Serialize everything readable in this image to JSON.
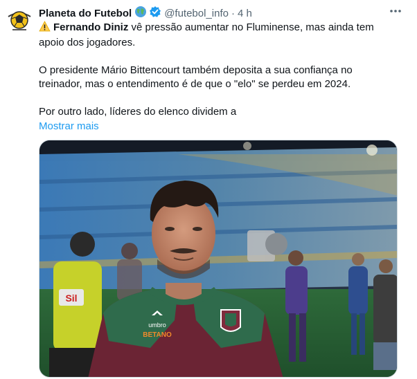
{
  "author": {
    "name": "Planeta do Futebol",
    "handle": "@futebol_info",
    "separator": "·",
    "time": "4 h",
    "avatar_icon": "ball-logo-icon",
    "badges": [
      "globe-icon",
      "verified-icon"
    ]
  },
  "tweet": {
    "line1_name": "Fernando Diniz",
    "line1_text": " vê pressão aumentar no Fluminense, mas ainda tem apoio dos jogadores.",
    "para2": "O presidente Mário Bittencourt também deposita a sua confiança no treinador, mas o entendimento é de que o \"elo\" se perdeu em 2024.",
    "para3": "Por outro lado, líderes do elenco dividem a",
    "show_more": "Mostrar mais",
    "warning_icon": "warning-icon"
  },
  "media": {
    "shirt_brand": "umbro",
    "shirt_sponsor": "BETANO",
    "board_text": "Sil"
  },
  "colors": {
    "link": "#1d9bf0",
    "verified": "#1d9bf0",
    "shirt_green": "#2f6b4c",
    "shirt_maroon": "#6b2434",
    "text_secondary": "#536471"
  }
}
